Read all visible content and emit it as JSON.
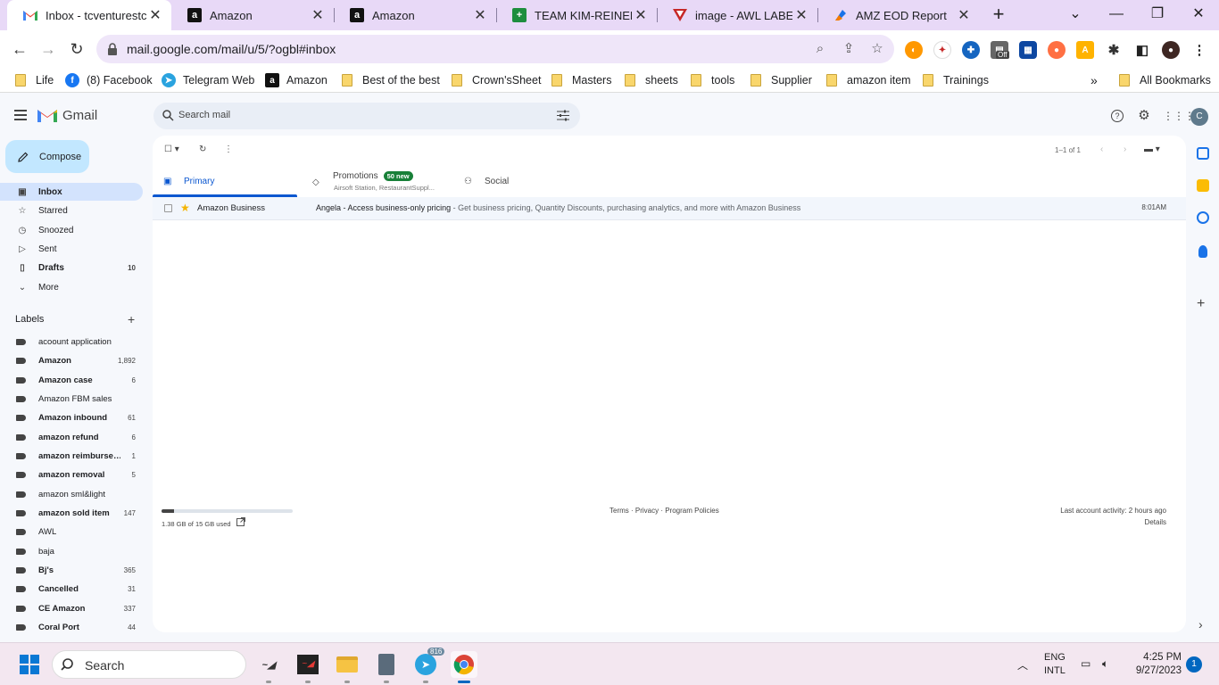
{
  "browser": {
    "tabs": [
      {
        "label": "Inbox - tcventurestc@",
        "icon": "gmail-icon"
      },
      {
        "label": "Amazon",
        "icon": "amazon-icon"
      },
      {
        "label": "Amazon",
        "icon": "amazon-icon"
      },
      {
        "label": "TEAM KIM-REINEL PR",
        "icon": "sheets-icon"
      },
      {
        "label": "image - AWL LABEL",
        "icon": "awl-icon"
      },
      {
        "label": "AMZ EOD Report",
        "icon": "report-icon"
      }
    ],
    "url": "mail.google.com/mail/u/5/?ogbl#inbox",
    "extension_badge": "Off",
    "bookmarks": [
      {
        "label": "Life",
        "type": "folder"
      },
      {
        "label": "(8) Facebook",
        "type": "site"
      },
      {
        "label": "Telegram Web",
        "type": "site"
      },
      {
        "label": "Amazon",
        "type": "site"
      },
      {
        "label": "Best of the best",
        "type": "folder"
      },
      {
        "label": "Crown'sSheet",
        "type": "folder"
      },
      {
        "label": "Masters",
        "type": "folder"
      },
      {
        "label": "sheets",
        "type": "folder"
      },
      {
        "label": "tools",
        "type": "folder"
      },
      {
        "label": "Supplier",
        "type": "folder"
      },
      {
        "label": "amazon item",
        "type": "folder"
      },
      {
        "label": "Trainings",
        "type": "folder"
      }
    ],
    "more_bookmarks": "»",
    "all_bookmarks": "All Bookmarks"
  },
  "gmail": {
    "app_name": "Gmail",
    "search_placeholder": "Search mail",
    "account_initial": "C",
    "compose_label": "Compose",
    "nav": [
      {
        "label": "Inbox",
        "icon": "inbox-icon",
        "count": ""
      },
      {
        "label": "Starred",
        "icon": "star-icon",
        "count": ""
      },
      {
        "label": "Snoozed",
        "icon": "clock-icon",
        "count": ""
      },
      {
        "label": "Sent",
        "icon": "send-icon",
        "count": ""
      },
      {
        "label": "Drafts",
        "icon": "draft-icon",
        "count": "10"
      },
      {
        "label": "More",
        "icon": "chevron-down-icon",
        "count": ""
      }
    ],
    "labels_title": "Labels",
    "labels": [
      {
        "name": "acoount application",
        "count": "",
        "bold": false
      },
      {
        "name": "Amazon",
        "count": "1,892",
        "bold": true
      },
      {
        "name": "Amazon case",
        "count": "6",
        "bold": true
      },
      {
        "name": "Amazon FBM sales",
        "count": "",
        "bold": false
      },
      {
        "name": "Amazon inbound",
        "count": "61",
        "bold": true
      },
      {
        "name": "amazon refund",
        "count": "6",
        "bold": true
      },
      {
        "name": "amazon reimburse…",
        "count": "1",
        "bold": true
      },
      {
        "name": "amazon removal",
        "count": "5",
        "bold": true
      },
      {
        "name": "amazon sml&light",
        "count": "",
        "bold": false
      },
      {
        "name": "amazon sold item",
        "count": "147",
        "bold": true
      },
      {
        "name": "AWL",
        "count": "",
        "bold": false
      },
      {
        "name": "baja",
        "count": "",
        "bold": false
      },
      {
        "name": "Bj's",
        "count": "365",
        "bold": true
      },
      {
        "name": "Cancelled",
        "count": "31",
        "bold": true
      },
      {
        "name": "CE Amazon",
        "count": "337",
        "bold": true
      },
      {
        "name": "Coral Port",
        "count": "44",
        "bold": true
      }
    ],
    "pager_text": "1–1 of 1",
    "category_tabs": [
      {
        "label": "Primary",
        "icon": "inbox-icon"
      },
      {
        "label": "Promotions",
        "icon": "tag-icon",
        "badge": "50 new",
        "sub": "Airsoft Station, RestaurantSuppl..."
      },
      {
        "label": "Social",
        "icon": "people-icon"
      }
    ],
    "emails": [
      {
        "sender": "Amazon Business",
        "subject": "Angela - Access business-only pricing",
        "snippet": " - Get business pricing, Quantity Discounts, purchasing analytics, and more with Amazon Business",
        "time": "8:01AM",
        "starred": true
      }
    ],
    "storage": {
      "text": "1.38 GB of 15 GB used",
      "fraction": 0.092
    },
    "footer_links": "Terms · Privacy · Program Policies",
    "last_activity": "Last account activity: 2 hours ago",
    "details": "Details"
  },
  "taskbar": {
    "search_placeholder": "Search",
    "telegram_badge": "816",
    "lang_line1": "ENG",
    "lang_line2": "INTL",
    "time": "4:25 PM",
    "date": "9/27/2023",
    "notifications": "1"
  }
}
